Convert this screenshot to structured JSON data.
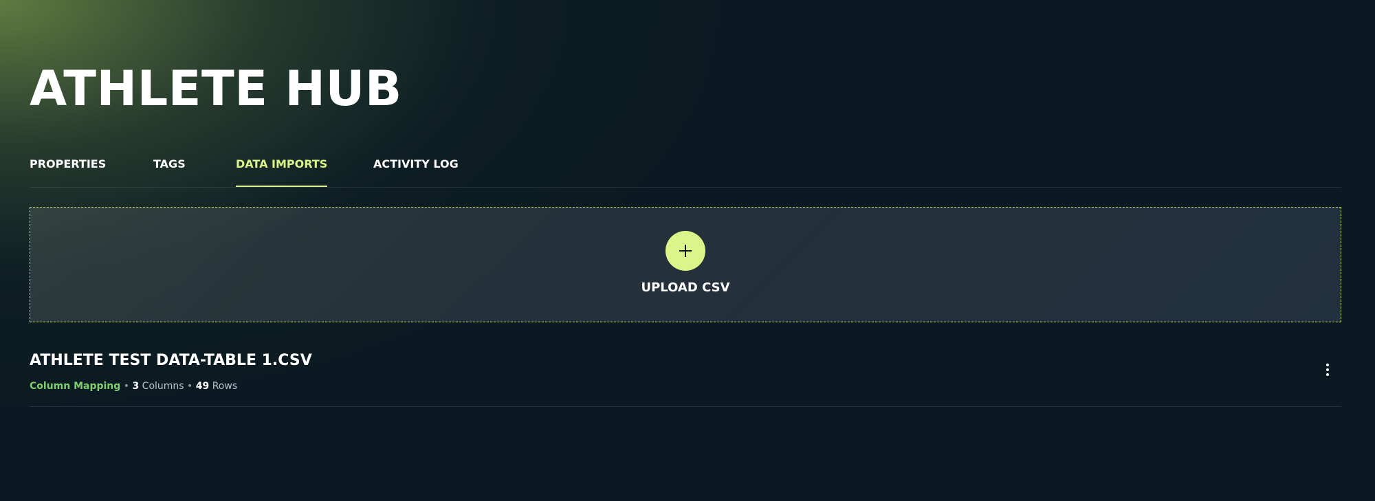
{
  "header": {
    "title": "ATHLETE HUB"
  },
  "tabs": [
    {
      "label": "PROPERTIES",
      "active": false
    },
    {
      "label": "TAGS",
      "active": false
    },
    {
      "label": "DATA IMPORTS",
      "active": true
    },
    {
      "label": "ACTIVITY LOG",
      "active": false
    }
  ],
  "upload": {
    "label": "UPLOAD CSV",
    "icon": "plus-icon"
  },
  "imports": [
    {
      "file_name": "ATHLETE TEST DATA-TABLE 1.CSV",
      "mapping_label": "Column Mapping",
      "separator": "•",
      "columns_count": "3",
      "columns_label": "Columns",
      "rows_count": "49",
      "rows_label": "Rows",
      "menu_icon": "more-vertical-icon"
    }
  ],
  "colors": {
    "accent": "#dcf58a",
    "link_green": "#7fcf6e",
    "background": "#0b1a22"
  }
}
